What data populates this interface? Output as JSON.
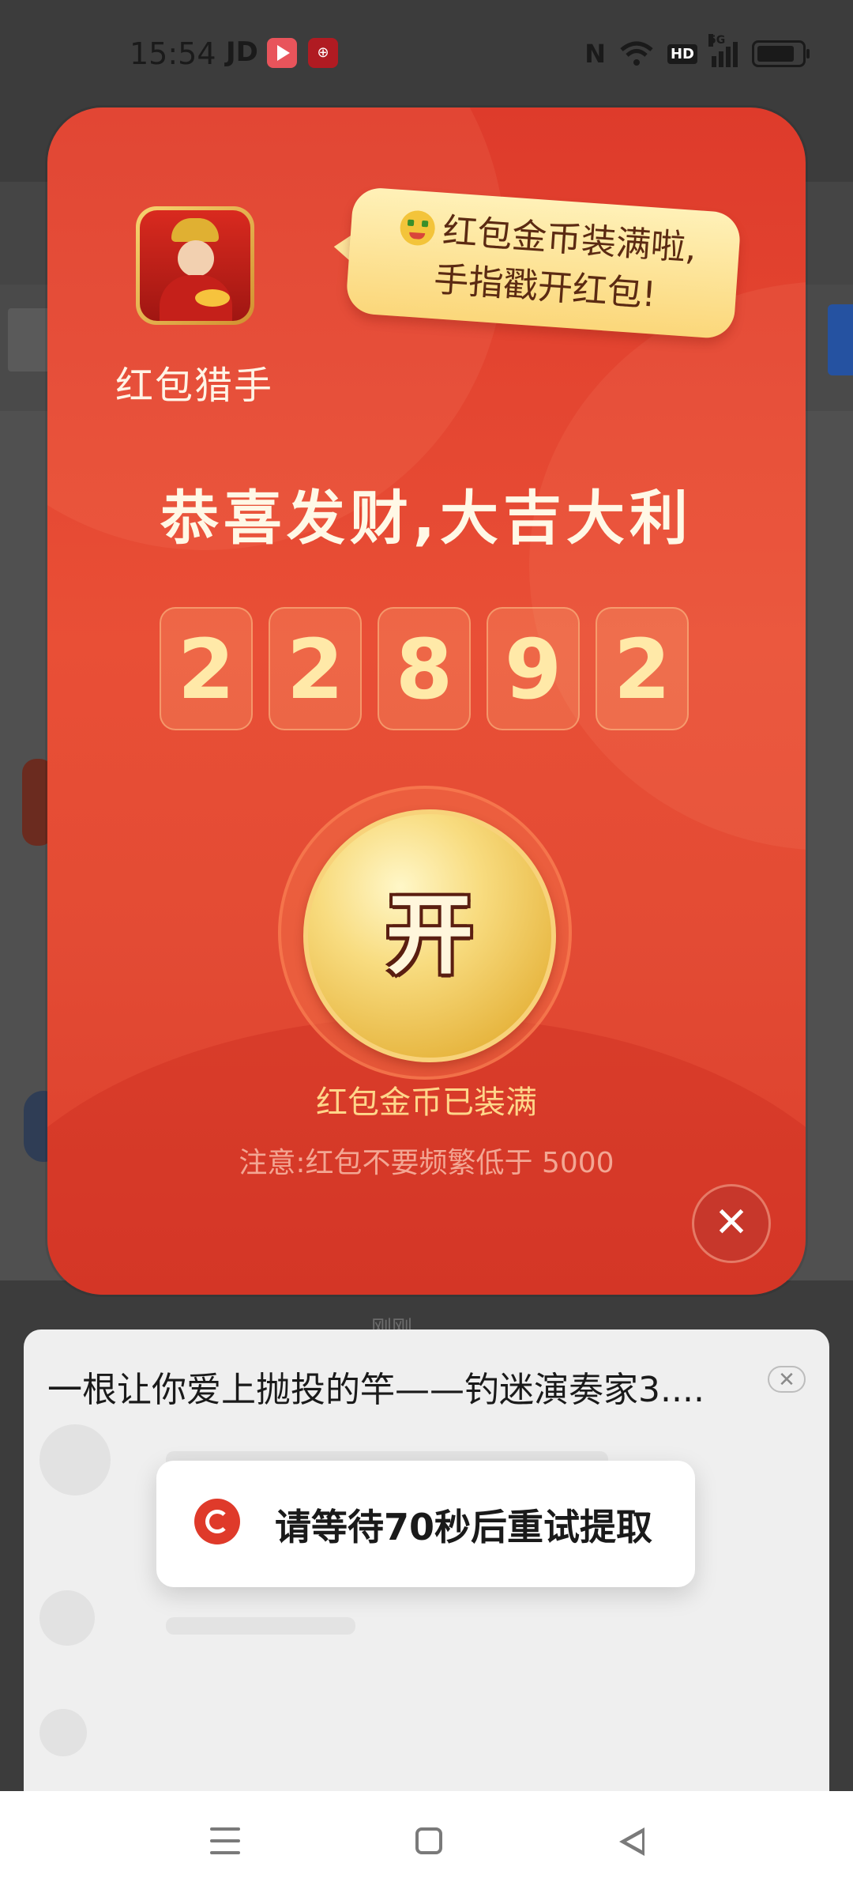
{
  "status_bar": {
    "time": "15:54",
    "carrier_label": "JD",
    "icons": [
      "video-app-icon",
      "notification-app-icon",
      "nfc-icon",
      "wifi-icon",
      "hd-icon",
      "5g-signal-icon",
      "battery-icon"
    ],
    "hd_label": "HD",
    "network_label": "5G",
    "nfc_label": "N"
  },
  "red_packet": {
    "app_name": "红包猎手",
    "bubble_text_line1": "红包金币装满啦,",
    "bubble_text_line2": "手指戳开红包!",
    "headline": "恭喜发财,大吉大利",
    "coin_digits": [
      "2",
      "2",
      "8",
      "9",
      "2"
    ],
    "open_button_label": "开",
    "status_text": "红包金币已装满",
    "notice_text": "注意:红包不要频繁低于 5000",
    "close_label": "✕",
    "colors": {
      "background": "#e94f36",
      "gold": "#f8dc80",
      "accent_text": "#ffd68a"
    }
  },
  "bottom_sheet": {
    "hint": "刚刚",
    "title": "一根让你爱上抛投的竿——钓迷演奏家3....",
    "close_label": "✕"
  },
  "toast": {
    "message": "请等待70秒后重试提取"
  },
  "nav_bar": {
    "buttons": [
      "menu",
      "home",
      "back"
    ]
  }
}
